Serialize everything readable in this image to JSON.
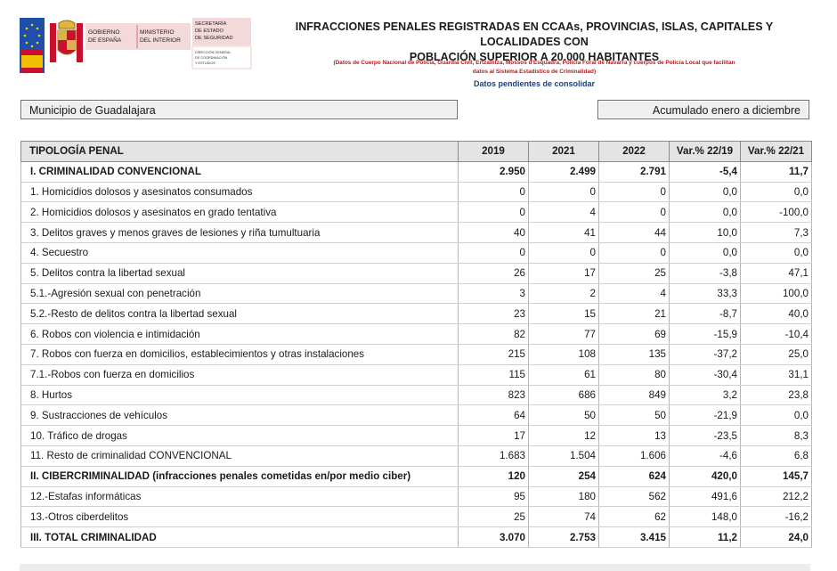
{
  "logo": {
    "gov_line1": "GOBIERNO",
    "gov_line2": "DE ESPAÑA",
    "min_line1": "MINISTERIO",
    "min_line2": "DEL INTERIOR",
    "sec_line1": "SECRETARÍA",
    "sec_line2": "DE ESTADO",
    "sec_line3": "DE SEGURIDAD",
    "dir_line1": "DIRECCIÓN GENERAL",
    "dir_line2": "DE COORDINACIÓN",
    "dir_line3": "Y ESTUDIOS"
  },
  "title_line1": "INFRACCIONES PENALES REGISTRADAS EN CCAAs, PROVINCIAS, ISLAS, CAPITALES Y LOCALIDADES CON",
  "title_line2": "POBLACIÓN SUPERIOR A 20.000 HABITANTES",
  "subtitle_line1": "(Datos de Cuerpo Nacional de Policía, Guardia Civil, Ertzaintza, Mossos d'Esquadra, Policía Foral de Navarra y cuerpos de Policía Local que facilitan",
  "subtitle_line2": "datos al Sistema Estadístico de Criminalidad)",
  "pending": "Datos pendientes de consolidar",
  "municipality": "Municipio de Guadalajara",
  "period": "Acumulado enero a diciembre",
  "colors": {
    "subtitle_red": "#c0141b",
    "pending_blue": "#1f3f73",
    "header_bg": "#e4e4e4"
  },
  "table": {
    "headers": [
      "TIPOLOGÍA PENAL",
      "2019",
      "2021",
      "2022",
      "Var.% 22/19",
      "Var.% 22/21"
    ],
    "rows": [
      {
        "label": "I. CRIMINALIDAD CONVENCIONAL",
        "v2019": "2.950",
        "v2021": "2.499",
        "v2022": "2.791",
        "var1": "-5,4",
        "var2": "11,7",
        "bold": true
      },
      {
        "label": "1. Homicidios dolosos y asesinatos consumados",
        "v2019": "0",
        "v2021": "0",
        "v2022": "0",
        "var1": "0,0",
        "var2": "0,0"
      },
      {
        "label": "2. Homicidios dolosos y asesinatos en grado tentativa",
        "v2019": "0",
        "v2021": "4",
        "v2022": "0",
        "var1": "0,0",
        "var2": "-100,0"
      },
      {
        "label": "3. Delitos graves y menos graves de lesiones y riña tumultuaria",
        "v2019": "40",
        "v2021": "41",
        "v2022": "44",
        "var1": "10,0",
        "var2": "7,3"
      },
      {
        "label": "4. Secuestro",
        "v2019": "0",
        "v2021": "0",
        "v2022": "0",
        "var1": "0,0",
        "var2": "0,0"
      },
      {
        "label": "5. Delitos contra la libertad sexual",
        "v2019": "26",
        "v2021": "17",
        "v2022": "25",
        "var1": "-3,8",
        "var2": "47,1"
      },
      {
        "label": "5.1.-Agresión sexual con penetración",
        "v2019": "3",
        "v2021": "2",
        "v2022": "4",
        "var1": "33,3",
        "var2": "100,0"
      },
      {
        "label": "5.2.-Resto de delitos contra la libertad sexual",
        "v2019": "23",
        "v2021": "15",
        "v2022": "21",
        "var1": "-8,7",
        "var2": "40,0"
      },
      {
        "label": "6. Robos con violencia e intimidación",
        "v2019": "82",
        "v2021": "77",
        "v2022": "69",
        "var1": "-15,9",
        "var2": "-10,4"
      },
      {
        "label": "7. Robos con fuerza en domicilios, establecimientos y otras instalaciones",
        "v2019": "215",
        "v2021": "108",
        "v2022": "135",
        "var1": "-37,2",
        "var2": "25,0"
      },
      {
        "label": "7.1.-Robos con fuerza en domicilios",
        "v2019": "115",
        "v2021": "61",
        "v2022": "80",
        "var1": "-30,4",
        "var2": "31,1"
      },
      {
        "label": "8. Hurtos",
        "v2019": "823",
        "v2021": "686",
        "v2022": "849",
        "var1": "3,2",
        "var2": "23,8"
      },
      {
        "label": "9. Sustracciones de vehículos",
        "v2019": "64",
        "v2021": "50",
        "v2022": "50",
        "var1": "-21,9",
        "var2": "0,0"
      },
      {
        "label": "10. Tráfico de drogas",
        "v2019": "17",
        "v2021": "12",
        "v2022": "13",
        "var1": "-23,5",
        "var2": "8,3"
      },
      {
        "label": "11. Resto de criminalidad CONVENCIONAL",
        "v2019": "1.683",
        "v2021": "1.504",
        "v2022": "1.606",
        "var1": "-4,6",
        "var2": "6,8"
      },
      {
        "label": "II. CIBERCRIMINALIDAD (infracciones penales cometidas en/por medio ciber)",
        "v2019": "120",
        "v2021": "254",
        "v2022": "624",
        "var1": "420,0",
        "var2": "145,7",
        "bold": true
      },
      {
        "label": "12.-Estafas informáticas",
        "v2019": "95",
        "v2021": "180",
        "v2022": "562",
        "var1": "491,6",
        "var2": "212,2"
      },
      {
        "label": "13.-Otros ciberdelitos",
        "v2019": "25",
        "v2021": "74",
        "v2022": "62",
        "var1": "148,0",
        "var2": "-16,2"
      },
      {
        "label": "III. TOTAL CRIMINALIDAD",
        "v2019": "3.070",
        "v2021": "2.753",
        "v2022": "3.415",
        "var1": "11,2",
        "var2": "24,0",
        "bold": true
      }
    ]
  }
}
